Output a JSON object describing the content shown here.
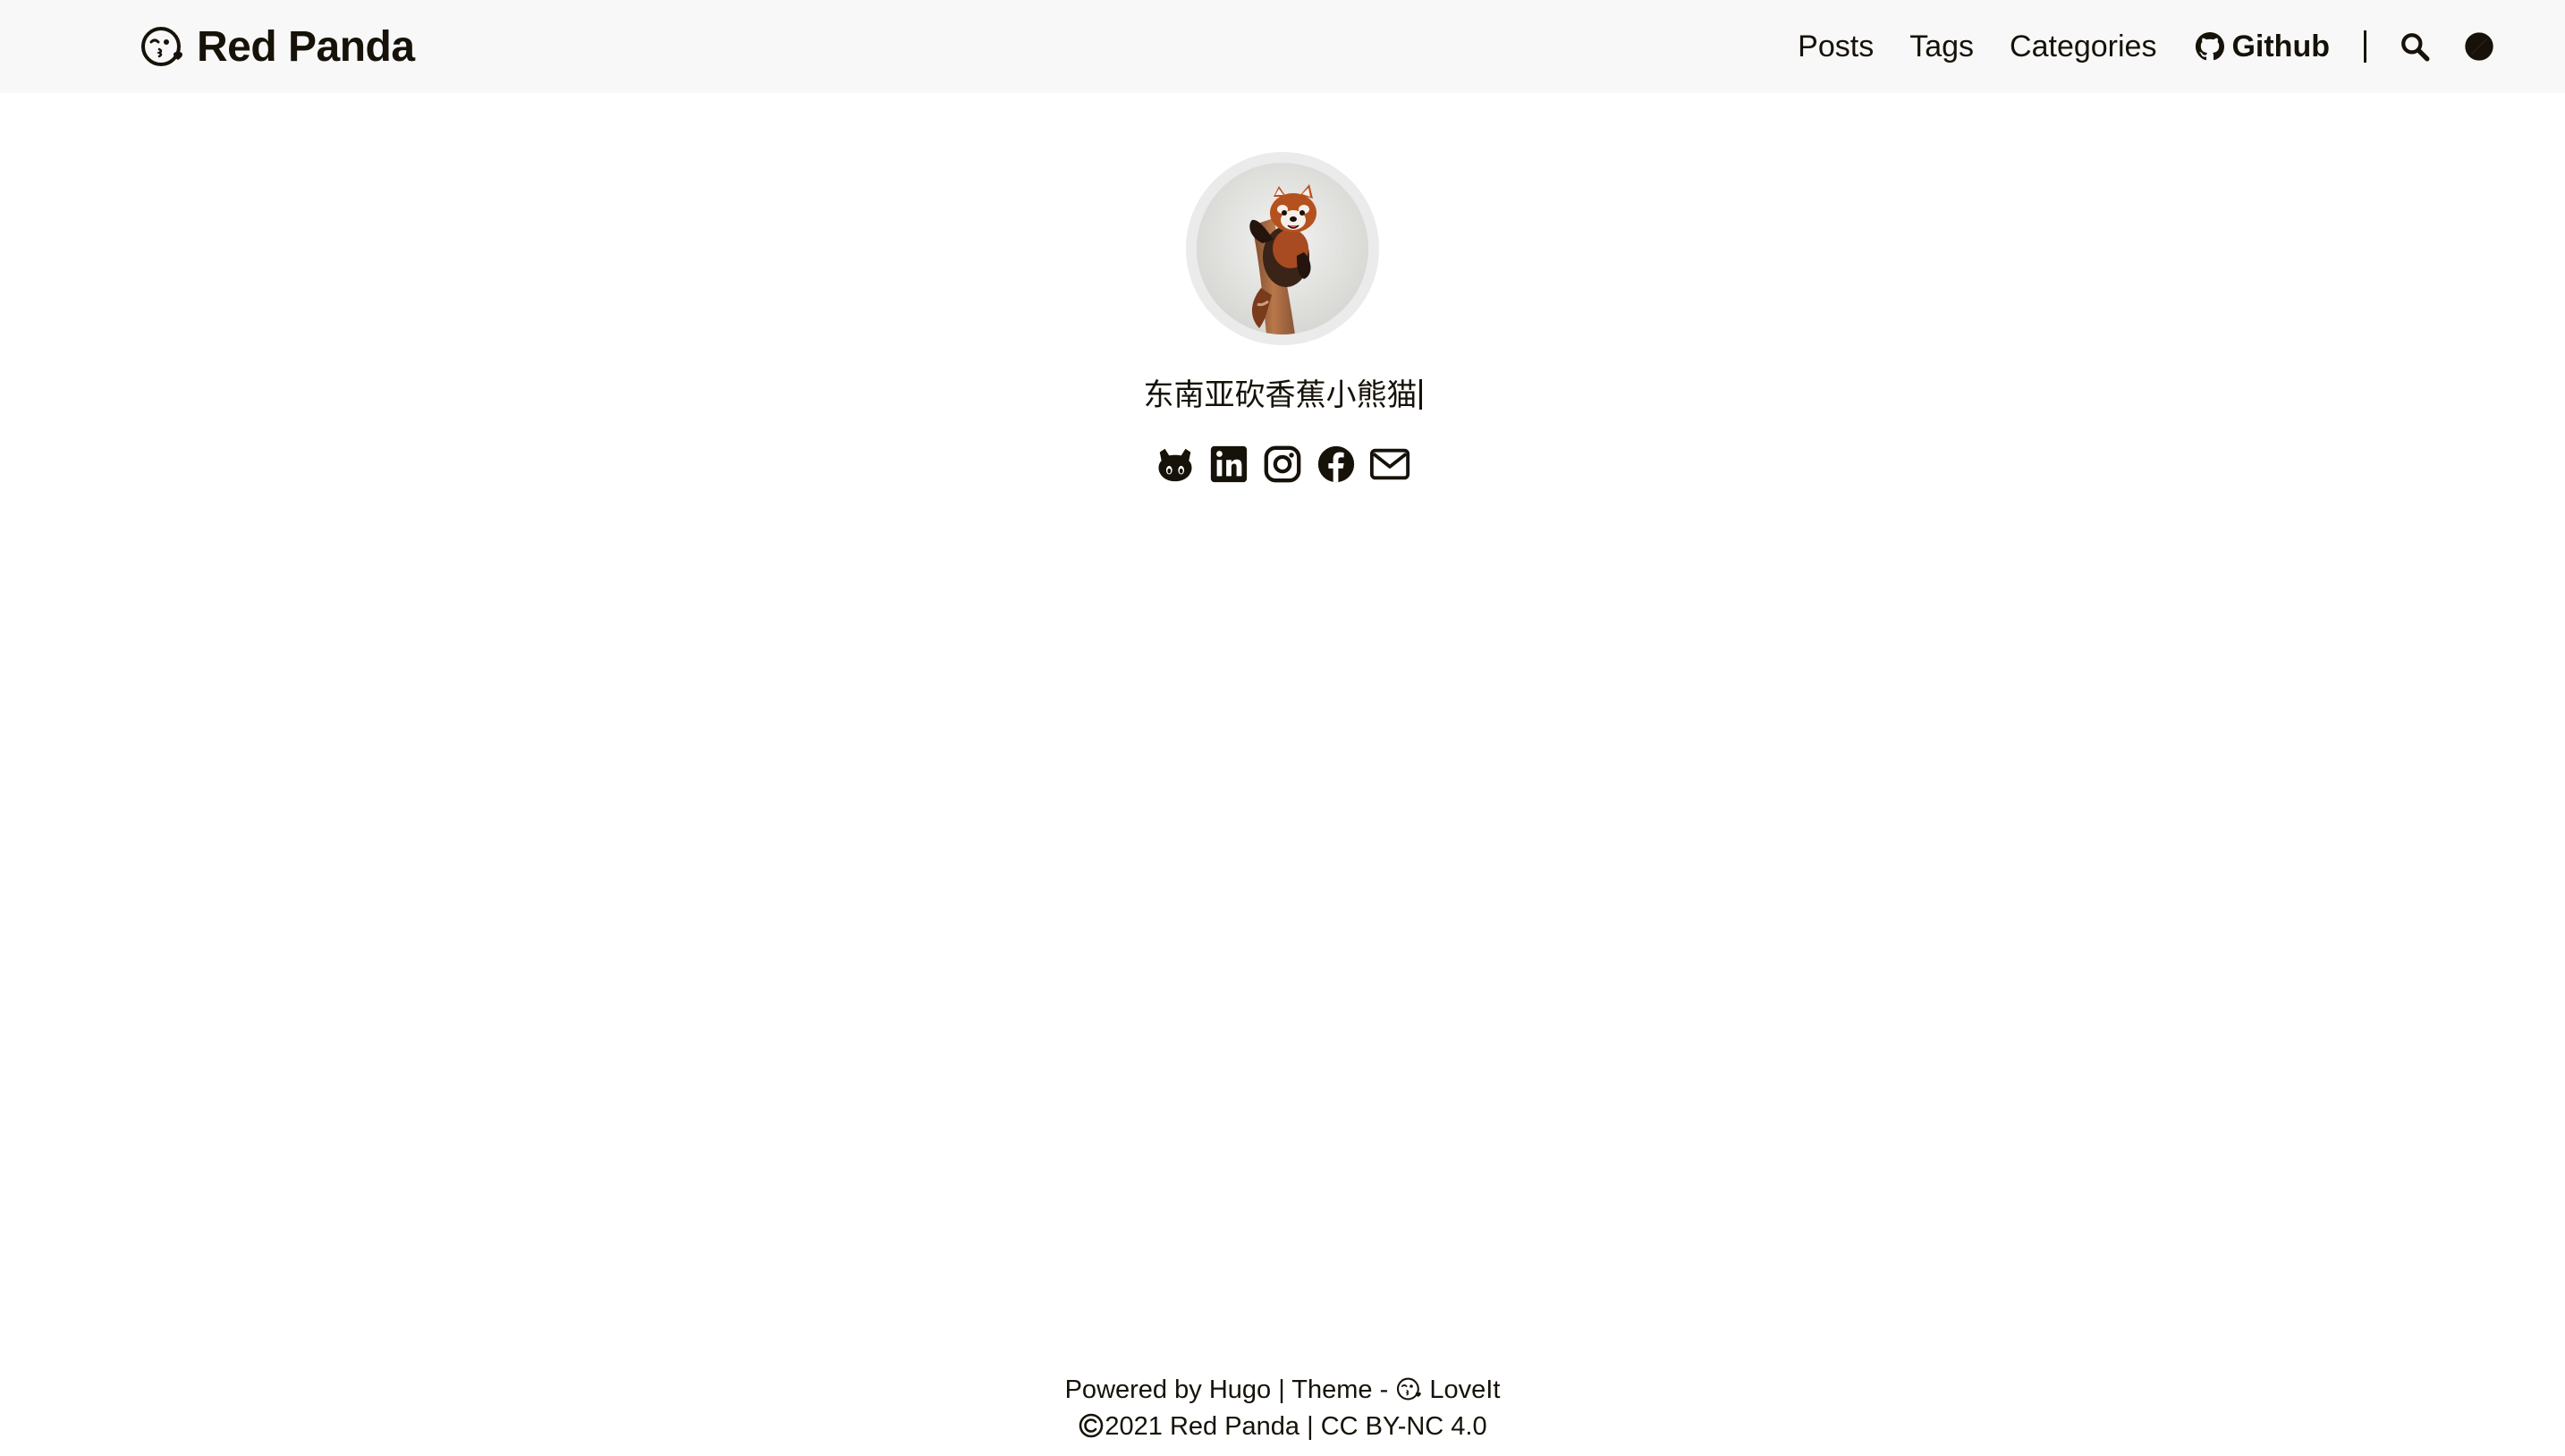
{
  "site": {
    "title": "Red Panda"
  },
  "nav": {
    "posts": "Posts",
    "tags": "Tags",
    "categories": "Categories",
    "github": "Github",
    "search_icon": "search-icon",
    "theme_icon": "theme-switch-icon"
  },
  "profile": {
    "subtitle": "东南亚砍香蕉小熊猫",
    "social": [
      "github-icon",
      "linkedin-icon",
      "instagram-icon",
      "facebook-icon",
      "email-icon"
    ]
  },
  "footer": {
    "powered_prefix": "Powered by",
    "hugo": "Hugo",
    "sep1": "|",
    "theme_prefix": "Theme -",
    "theme_name": "LoveIt",
    "year": "2021",
    "author": "Red Panda",
    "sep2": "|",
    "license": "CC BY-NC 4.0"
  },
  "colors": {
    "header_bg": "#f8f8f8",
    "text": "#161209",
    "avatar_ring": "#ebebeb"
  }
}
